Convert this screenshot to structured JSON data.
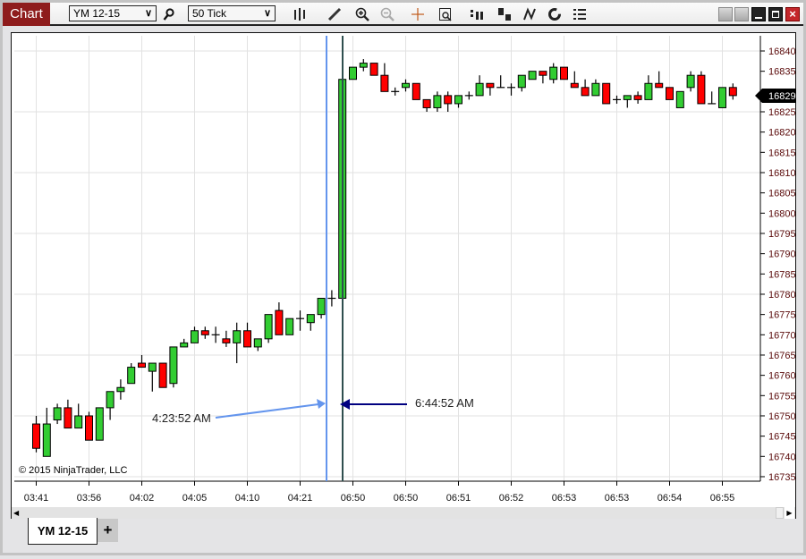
{
  "window": {
    "title": "Chart"
  },
  "toolbar": {
    "instrument": "YM 12-15",
    "period": "50 Tick",
    "icons": [
      "search-icon",
      "bar-style-icon",
      "pencil-icon",
      "zoom-in-icon",
      "zoom-out-icon",
      "crosshair-icon",
      "data-box-icon",
      "chart-trader-icon",
      "strategies-icon",
      "indicators-icon",
      "reload-icon",
      "properties-list-icon"
    ],
    "window_buttons": [
      "tile-icon",
      "tile-icon",
      "minimize-icon",
      "maximize-icon",
      "close-icon"
    ]
  },
  "chart": {
    "copyright": "© 2015 NinjaTrader, LLC",
    "current_price": "16829",
    "annotations": [
      {
        "label": "4:23:52 AM",
        "color": "#6495ed"
      },
      {
        "label": "6:44:52 AM",
        "color": "#000080"
      }
    ],
    "colors": {
      "up": "#32cd32",
      "down": "#ff0000",
      "price_labels": "#5a0a0a",
      "vline_1": "#6495ed",
      "vline_2": "#2f4f4f"
    }
  },
  "chart_data": {
    "type": "candlestick",
    "ylim": [
      16733,
      16843
    ],
    "y_ticks": [
      16840,
      16835,
      16830,
      16825,
      16820,
      16815,
      16810,
      16805,
      16800,
      16795,
      16790,
      16785,
      16780,
      16775,
      16770,
      16765,
      16760,
      16755,
      16750,
      16745,
      16740,
      16735
    ],
    "x_tick_labels": [
      "03:41",
      "03:56",
      "04:02",
      "04:05",
      "04:10",
      "04:21",
      "06:50",
      "06:50",
      "06:51",
      "06:52",
      "06:53",
      "06:53",
      "06:54",
      "06:55"
    ],
    "grid": true,
    "ohlc": [
      [
        16748,
        16750,
        16741,
        16742
      ],
      [
        16740,
        16752,
        16740,
        16748
      ],
      [
        16749,
        16753,
        16748,
        16752
      ],
      [
        16752,
        16754,
        16747,
        16747
      ],
      [
        16747,
        16753,
        16747,
        16750
      ],
      [
        16750,
        16751,
        16744,
        16744
      ],
      [
        16744,
        16752,
        16744,
        16752
      ],
      [
        16752,
        16756,
        16749,
        16756
      ],
      [
        16756,
        16759,
        16754,
        16757
      ],
      [
        16758,
        16763,
        16758,
        16762
      ],
      [
        16763,
        16765,
        16762,
        16762
      ],
      [
        16761,
        16763,
        16756,
        16763
      ],
      [
        16763,
        16763,
        16757,
        16757
      ],
      [
        16758,
        16767,
        16757,
        16767
      ],
      [
        16767,
        16769,
        16767,
        16768
      ],
      [
        16768,
        16772,
        16768,
        16771
      ],
      [
        16771,
        16772,
        16769,
        16770
      ],
      [
        16770,
        16772,
        16768,
        16770
      ],
      [
        16769,
        16771,
        16767,
        16768
      ],
      [
        16768,
        16773,
        16763,
        16771
      ],
      [
        16771,
        16773,
        16767,
        16767
      ],
      [
        16767,
        16769,
        16766,
        16769
      ],
      [
        16769,
        16775,
        16768,
        16775
      ],
      [
        16776,
        16778,
        16770,
        16770
      ],
      [
        16770,
        16774,
        16770,
        16774
      ],
      [
        16774,
        16776,
        16771,
        16774
      ],
      [
        16773,
        16775,
        16771,
        16775
      ],
      [
        16775,
        16779,
        16774,
        16779
      ],
      [
        16779,
        16781,
        16777,
        16779
      ],
      [
        16779,
        16833,
        16779,
        16833
      ],
      [
        16833,
        16836,
        16833,
        16836
      ],
      [
        16836,
        16838,
        16835,
        16837
      ],
      [
        16837,
        16837,
        16834,
        16834
      ],
      [
        16834,
        16837,
        16830,
        16830
      ],
      [
        16830,
        16831,
        16829,
        16830
      ],
      [
        16831,
        16833,
        16830,
        16832
      ],
      [
        16832,
        16832,
        16828,
        16828
      ],
      [
        16828,
        16828,
        16825,
        16826
      ],
      [
        16826,
        16830,
        16825,
        16829
      ],
      [
        16829,
        16830,
        16825,
        16827
      ],
      [
        16827,
        16829,
        16826,
        16829
      ],
      [
        16829,
        16830,
        16828,
        16829
      ],
      [
        16829,
        16834,
        16829,
        16832
      ],
      [
        16832,
        16832,
        16829,
        16831
      ],
      [
        16831,
        16834,
        16831,
        16831
      ],
      [
        16831,
        16832,
        16829,
        16831
      ],
      [
        16831,
        16834,
        16830,
        16834
      ],
      [
        16833,
        16835,
        16833,
        16835
      ],
      [
        16835,
        16835,
        16832,
        16834
      ],
      [
        16833,
        16837,
        16832,
        16836
      ],
      [
        16836,
        16836,
        16833,
        16833
      ],
      [
        16832,
        16835,
        16831,
        16831
      ],
      [
        16831,
        16833,
        16829,
        16829
      ],
      [
        16829,
        16833,
        16829,
        16832
      ],
      [
        16832,
        16832,
        16827,
        16827
      ],
      [
        16828,
        16829,
        16827,
        16828
      ],
      [
        16828,
        16829,
        16826,
        16829
      ],
      [
        16829,
        16830,
        16827,
        16828
      ],
      [
        16828,
        16834,
        16828,
        16832
      ],
      [
        16832,
        16835,
        16831,
        16831
      ],
      [
        16831,
        16831,
        16828,
        16828
      ],
      [
        16826,
        16830,
        16826,
        16830
      ],
      [
        16831,
        16835,
        16830,
        16834
      ],
      [
        16834,
        16835,
        16827,
        16827
      ],
      [
        16827,
        16830,
        16827,
        16827
      ],
      [
        16826,
        16831,
        16826,
        16831
      ],
      [
        16831,
        16832,
        16828,
        16829
      ]
    ]
  },
  "tabs": [
    {
      "label": "YM 12-15"
    }
  ],
  "add_tab": "+"
}
